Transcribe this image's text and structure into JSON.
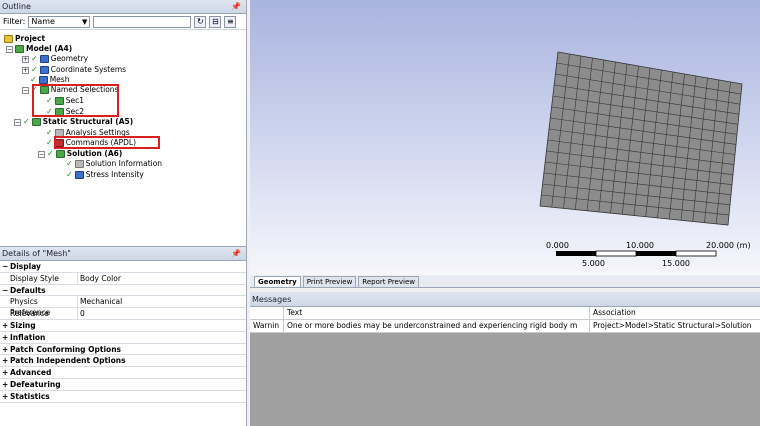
{
  "outline": {
    "title": "Outline",
    "pin": "↕",
    "filter_label": "Filter:",
    "filter_value": "Name",
    "tree": [
      {
        "label": "Project",
        "bold": true
      },
      {
        "label": "Model (A4)",
        "bold": true
      },
      {
        "label": "Geometry"
      },
      {
        "label": "Coordinate Systems"
      },
      {
        "label": "Mesh"
      },
      {
        "label": "Named Selections"
      },
      {
        "label": "Sec1"
      },
      {
        "label": "Sec2"
      },
      {
        "label": "Static Structural (A5)",
        "bold": true
      },
      {
        "label": "Analysis Settings"
      },
      {
        "label": "Commands (APDL)"
      },
      {
        "label": "Solution (A6)",
        "bold": true
      },
      {
        "label": "Solution Information"
      },
      {
        "label": "Stress Intensity"
      }
    ]
  },
  "details": {
    "title": "Details of \"Mesh\"",
    "rows": [
      {
        "type": "section",
        "label": "Display",
        "sign": "−"
      },
      {
        "type": "row",
        "key": "Display Style",
        "value": "Body Color"
      },
      {
        "type": "section",
        "label": "Defaults",
        "sign": "−"
      },
      {
        "type": "row",
        "key": "Physics Preference",
        "value": "Mechanical"
      },
      {
        "type": "row",
        "key": "Relevance",
        "value": "0"
      },
      {
        "type": "section",
        "label": "Sizing",
        "sign": "+"
      },
      {
        "type": "section",
        "label": "Inflation",
        "sign": "+"
      },
      {
        "type": "section",
        "label": "Patch Conforming Options",
        "sign": "+"
      },
      {
        "type": "section",
        "label": "Patch Independent Options",
        "sign": "+"
      },
      {
        "type": "section",
        "label": "Advanced",
        "sign": "+"
      },
      {
        "type": "section",
        "label": "Defeaturing",
        "sign": "+"
      },
      {
        "type": "section",
        "label": "Statistics",
        "sign": "+"
      }
    ]
  },
  "scale_bar": {
    "top_labels": [
      "0.000",
      "10.000",
      "20.000 (m)"
    ],
    "bottom_labels": [
      "5.000",
      "15.000"
    ]
  },
  "tabs": [
    "Geometry",
    "Print Preview",
    "Report Preview"
  ],
  "messages": {
    "title": "Messages",
    "headers": [
      "",
      "Text",
      "Association"
    ],
    "rows": [
      [
        "Warnin",
        "One or more bodies may be underconstrained and experiencing rigid body m",
        "Project>Model>Static Structural>Solution"
      ]
    ]
  },
  "colors": {
    "highlight_box": "#d82020",
    "mesh_fill": "#8c8c8c",
    "mesh_line": "#333333"
  }
}
